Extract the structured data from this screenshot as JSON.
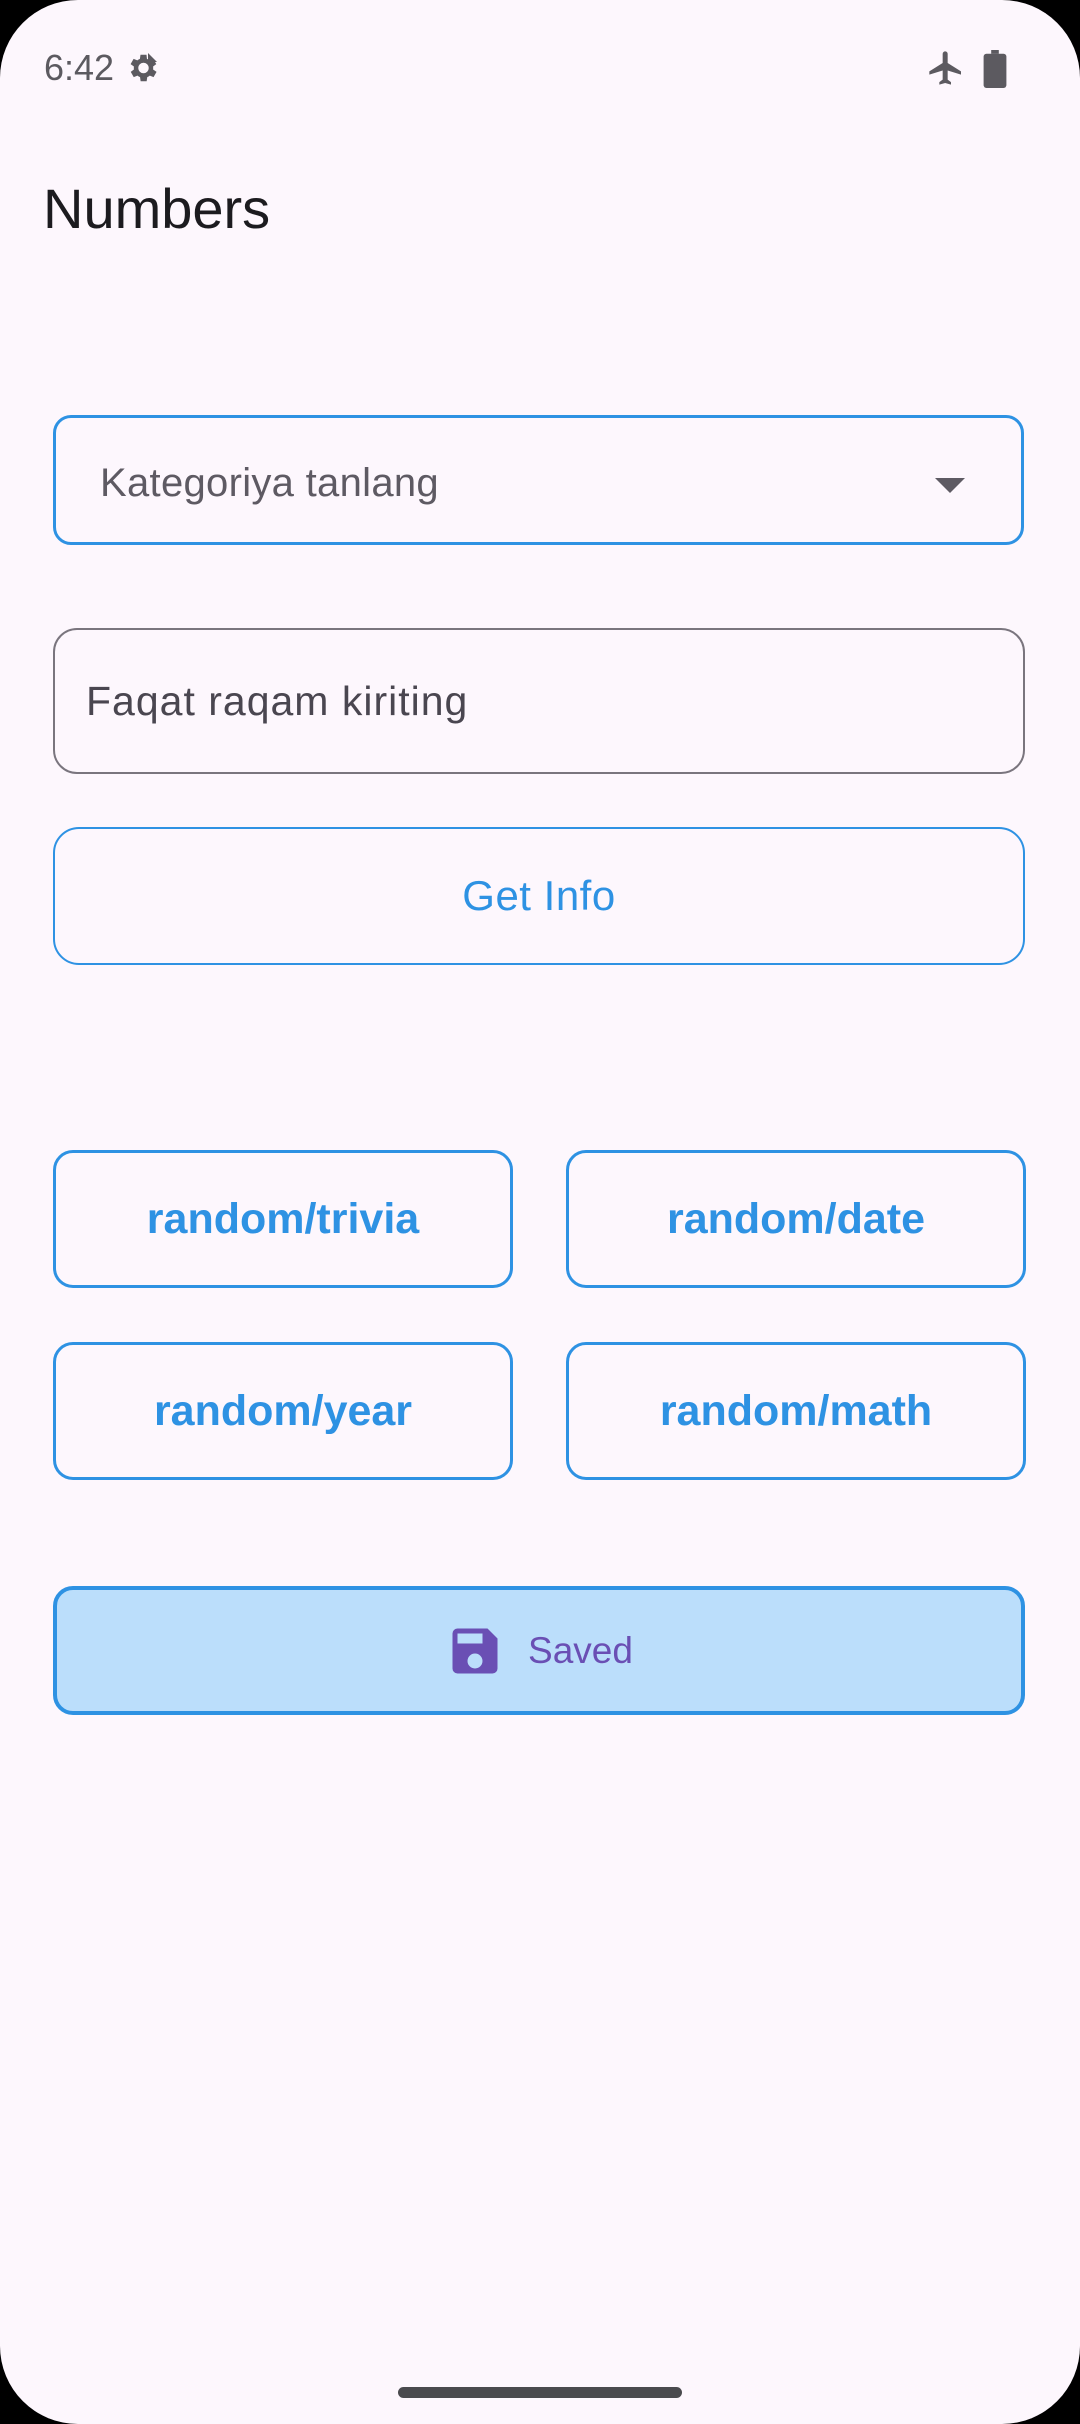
{
  "status_bar": {
    "time": "6:42",
    "icons": [
      "settings-icon",
      "airplane-mode-icon",
      "battery-icon"
    ]
  },
  "app_bar": {
    "title": "Numbers"
  },
  "category_dropdown": {
    "label": "Kategoriya tanlang",
    "icon": "arrow-drop-down-icon"
  },
  "number_input": {
    "value": "",
    "placeholder": "Faqat raqam kiriting"
  },
  "get_info_button": {
    "label": "Get Info"
  },
  "random_buttons": [
    {
      "label": "random/trivia"
    },
    {
      "label": "random/date"
    },
    {
      "label": "random/year"
    },
    {
      "label": "random/math"
    }
  ],
  "saved_button": {
    "label": "Saved",
    "icon": "save-icon"
  },
  "colors": {
    "background": "#fdf7fd",
    "accent": "#2e92e3",
    "saved_fill": "#bbdefb",
    "saved_text": "#6a4fb4",
    "title_text": "#1c1b1f"
  }
}
